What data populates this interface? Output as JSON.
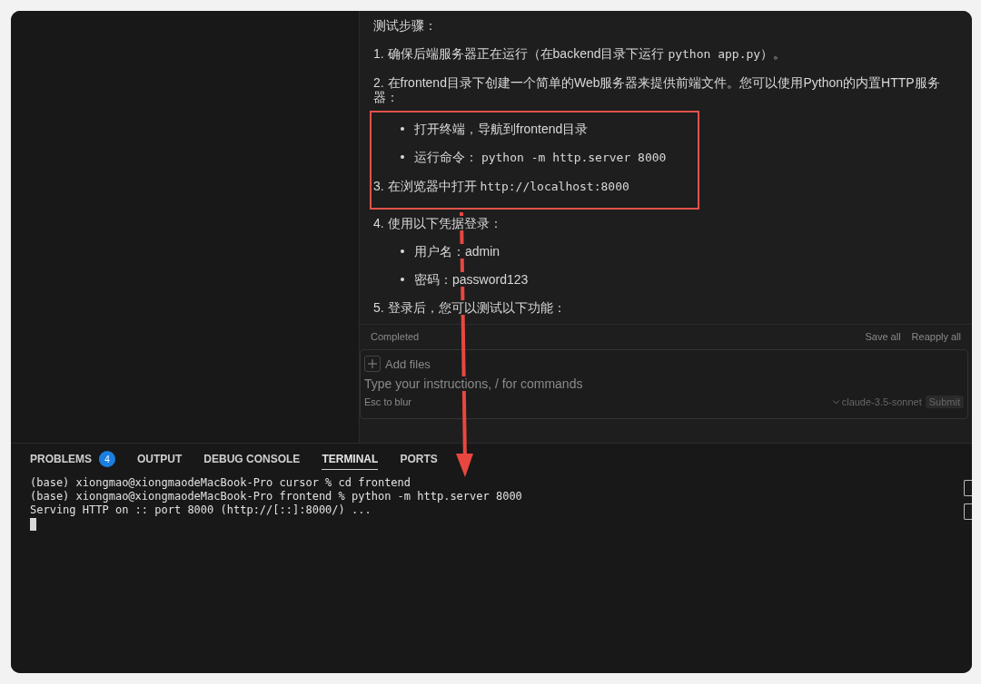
{
  "chat": {
    "heading": "测试步骤：",
    "items": [
      {
        "kind": "step",
        "highlighted": false,
        "parts": [
          {
            "text": "1. 确保后端服务器正在运行（在backend目录下运行 ",
            "code": false
          },
          {
            "text": "python app.py",
            "code": true
          },
          {
            "text": "）。",
            "code": false
          }
        ]
      },
      {
        "kind": "step",
        "highlighted": false,
        "parts": [
          {
            "text": "2. 在frontend目录下创建一个简单的Web服务器来提供前端文件。您可以使用Python的内置HTTP服务器：",
            "code": false
          }
        ]
      },
      {
        "kind": "bullet",
        "highlighted": true,
        "parts": [
          {
            "text": "打开终端，导航到frontend目录",
            "code": false
          }
        ]
      },
      {
        "kind": "bullet",
        "highlighted": true,
        "parts": [
          {
            "text": "运行命令： ",
            "code": false
          },
          {
            "text": "python -m http.server 8000",
            "code": true
          }
        ]
      },
      {
        "kind": "step",
        "highlighted": true,
        "parts": [
          {
            "text": "3. 在浏览器中打开 ",
            "code": false
          },
          {
            "text": "http://localhost:8000",
            "code": true
          }
        ]
      },
      {
        "kind": "step",
        "highlighted": false,
        "parts": [
          {
            "text": "4. 使用以下凭据登录：",
            "code": false
          }
        ]
      },
      {
        "kind": "bullet",
        "highlighted": false,
        "parts": [
          {
            "text": "用户名：admin",
            "code": false
          }
        ]
      },
      {
        "kind": "bullet",
        "highlighted": false,
        "parts": [
          {
            "text": "密码：password123",
            "code": false
          }
        ]
      },
      {
        "kind": "step",
        "highlighted": false,
        "parts": [
          {
            "text": "5. 登录后，您可以测试以下功能：",
            "code": false
          }
        ]
      }
    ],
    "status": "Completed",
    "actions": [
      "Save all",
      "Reapply all"
    ],
    "composer": {
      "add_files": "Add files",
      "placeholder": "Type your instructions, / for commands",
      "hint": "Esc to blur",
      "model": "claude-3.5-sonnet",
      "submit": "Submit"
    }
  },
  "panel": {
    "tabs": [
      {
        "label": "PROBLEMS",
        "selected": false,
        "badge": "4"
      },
      {
        "label": "OUTPUT",
        "selected": false
      },
      {
        "label": "DEBUG CONSOLE",
        "selected": false
      },
      {
        "label": "TERMINAL",
        "selected": true
      },
      {
        "label": "PORTS",
        "selected": false
      }
    ],
    "terminal_lines": [
      "(base) xiongmao@xiongmaodeMacBook-Pro cursor % cd frontend",
      "(base) xiongmao@xiongmaodeMacBook-Pro frontend % python -m http.server 8000",
      "Serving HTTP on :: port 8000 (http://[::]:8000/) ..."
    ],
    "cursor_visible": true
  },
  "annotations": {
    "arrow": true
  }
}
